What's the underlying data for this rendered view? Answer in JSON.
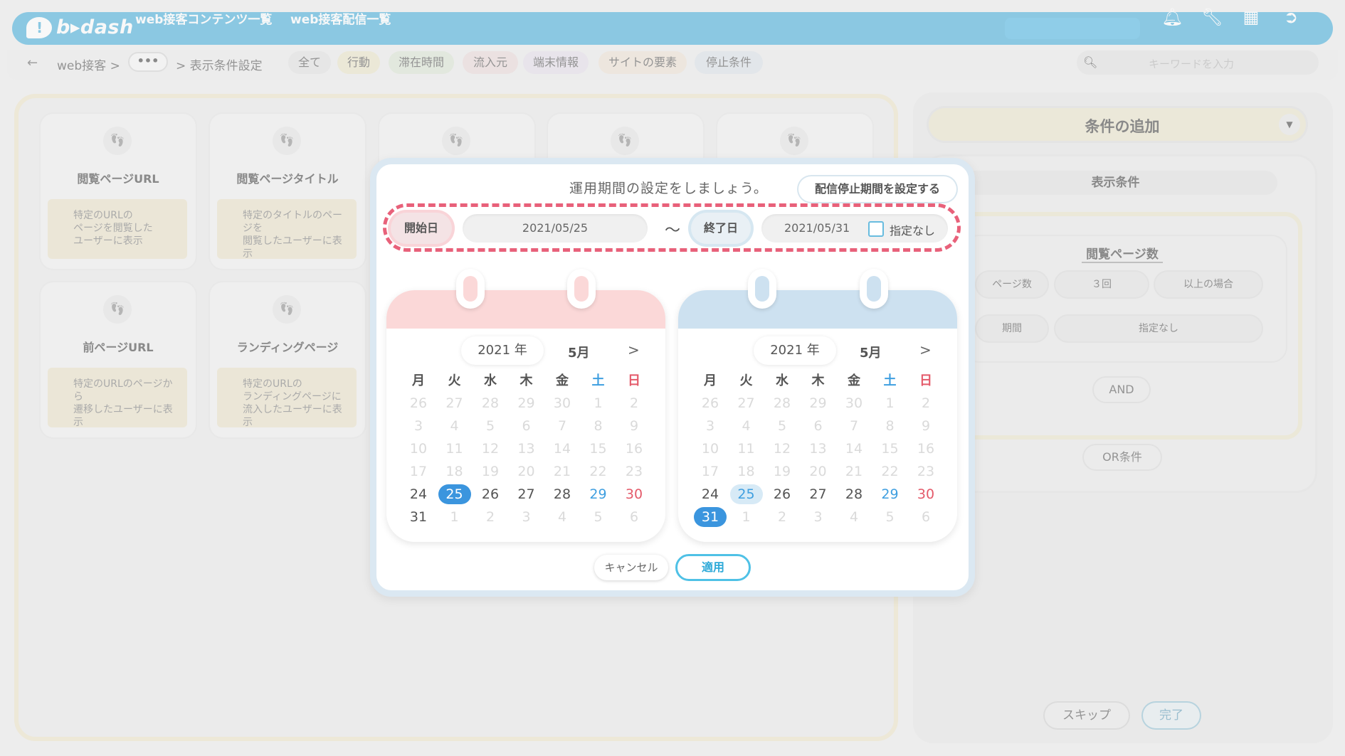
{
  "header": {
    "logo": "b▸dash",
    "nav": [
      "web接客コンテンツ一覧",
      "web接客配信一覧"
    ],
    "icons": [
      "bell-icon",
      "wrench-icon",
      "grid-icon",
      "logout-icon"
    ]
  },
  "breadcrumb": {
    "items": [
      "web接客",
      ">",
      "•••",
      ">",
      "表示条件設定"
    ]
  },
  "tabs": [
    {
      "label": "全て",
      "color": "#e3e3e3"
    },
    {
      "label": "行動",
      "color": "#ece6cc"
    },
    {
      "label": "滞在時間",
      "color": "#dde6d7"
    },
    {
      "label": "流入元",
      "color": "#ecdcdc"
    },
    {
      "label": "端末情報",
      "color": "#e6e0ec"
    },
    {
      "label": "サイトの要素",
      "color": "#eee4d8"
    },
    {
      "label": "停止条件",
      "color": "#dee4ea"
    }
  ],
  "search": {
    "placeholder": "キーワードを入力"
  },
  "cards": [
    {
      "title": "閲覧ページURL",
      "desc": "特定のURLの\nページを閲覧した\nユーザーに表示"
    },
    {
      "title": "閲覧ページタイトル",
      "desc": "特定のタイトルのページを\n閲覧したユーザーに表示"
    },
    {
      "title": "前ページURL",
      "desc": "特定のURLのページから\n遷移したユーザーに表示"
    },
    {
      "title": "ランディングページ",
      "desc": "特定のURLの\nランディングページに\n流入したユーザーに表示"
    }
  ],
  "right": {
    "add_condition": "条件の追加",
    "display_condition": "表示条件",
    "page_views_title": "閲覧ページ数",
    "row1": [
      "ページ数",
      "３回",
      "以上の場合"
    ],
    "row2": [
      "期間",
      "指定なし"
    ],
    "and": "AND",
    "or": "OR条件",
    "skip": "スキップ",
    "done": "完了"
  },
  "modal": {
    "title": "運用期間の設定をしましょう。",
    "stop_button": "配信停止期間を設定する",
    "start_label": "開始日",
    "start_date": "2021/05/25",
    "tilde": "〜",
    "end_label": "終了日",
    "end_date": "2021/05/31",
    "no_spec": "指定なし",
    "cancel": "キャンセル",
    "apply": "適用"
  },
  "calendar_left": {
    "year": "2021 年",
    "month": "5月",
    "next": ">",
    "weekdays": [
      "月",
      "火",
      "水",
      "木",
      "金",
      "土",
      "日"
    ],
    "weeks": [
      [
        "26",
        "27",
        "28",
        "29",
        "30",
        "1",
        "2"
      ],
      [
        "3",
        "4",
        "5",
        "6",
        "7",
        "8",
        "9"
      ],
      [
        "10",
        "11",
        "12",
        "13",
        "14",
        "15",
        "16"
      ],
      [
        "17",
        "18",
        "19",
        "20",
        "21",
        "22",
        "23"
      ],
      [
        "24",
        "25",
        "26",
        "27",
        "28",
        "29",
        "30"
      ],
      [
        "31",
        "1",
        "2",
        "3",
        "4",
        "5",
        "6"
      ]
    ],
    "selected": "25"
  },
  "calendar_right": {
    "year": "2021 年",
    "month": "5月",
    "next": ">",
    "weekdays": [
      "月",
      "火",
      "水",
      "木",
      "金",
      "土",
      "日"
    ],
    "weeks": [
      [
        "26",
        "27",
        "28",
        "29",
        "30",
        "1",
        "2"
      ],
      [
        "3",
        "4",
        "5",
        "6",
        "7",
        "8",
        "9"
      ],
      [
        "10",
        "11",
        "12",
        "13",
        "14",
        "15",
        "16"
      ],
      [
        "17",
        "18",
        "19",
        "20",
        "21",
        "22",
        "23"
      ],
      [
        "24",
        "25",
        "26",
        "27",
        "28",
        "29",
        "30"
      ],
      [
        "31",
        "1",
        "2",
        "3",
        "4",
        "5",
        "6"
      ]
    ],
    "selected": "31",
    "range_start": "25"
  }
}
